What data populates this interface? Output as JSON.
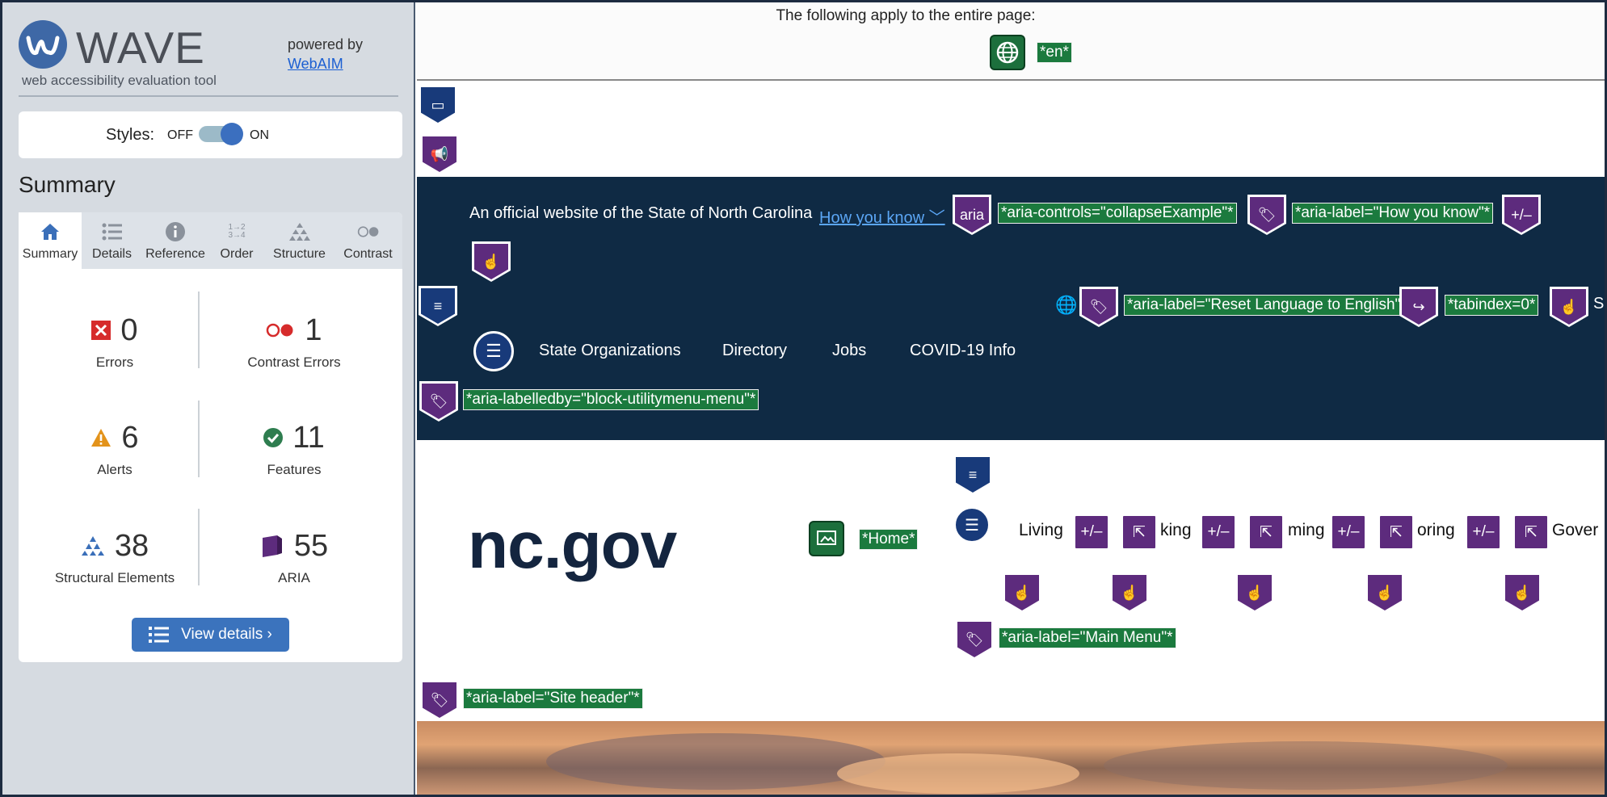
{
  "sidebar": {
    "logo_text": "WAVE",
    "tagline": "web accessibility evaluation tool",
    "powered_by": "powered by",
    "webaim_link": "WebAIM",
    "styles": {
      "label": "Styles:",
      "off": "OFF",
      "on": "ON",
      "enabled": true
    },
    "summary_heading": "Summary",
    "tabs": [
      {
        "label": "Summary",
        "icon": "home-icon",
        "active": true
      },
      {
        "label": "Details",
        "icon": "list-icon",
        "active": false
      },
      {
        "label": "Reference",
        "icon": "info-icon",
        "active": false
      },
      {
        "label": "Order",
        "icon": "order-icon",
        "active": false
      },
      {
        "label": "Structure",
        "icon": "structure-icon",
        "active": false
      },
      {
        "label": "Contrast",
        "icon": "contrast-icon",
        "active": false
      }
    ],
    "stats": {
      "errors": {
        "count": "0",
        "label": "Errors"
      },
      "contrast_errors": {
        "count": "1",
        "label": "Contrast Errors"
      },
      "alerts": {
        "count": "6",
        "label": "Alerts"
      },
      "features": {
        "count": "11",
        "label": "Features"
      },
      "structural": {
        "count": "38",
        "label": "Structural Elements"
      },
      "aria": {
        "count": "55",
        "label": "ARIA"
      }
    },
    "view_details": "View details ›"
  },
  "page": {
    "top_note": "The following apply to the entire page:",
    "lang_tag": "*en*",
    "official_text": "An official website of the State of North Carolina",
    "how_you_know": "How you know",
    "aria_icon_text": "aria",
    "tags": {
      "aria_controls": "*aria-controls=\"collapseExample\"*",
      "aria_label_how": "*aria-label=\"How you know\"*",
      "aria_label_reset": "*aria-label=\"Reset Language to English\"*",
      "tabindex": "*tabindex=0*",
      "aria_labelledby": "*aria-labelledby=\"block-utilitymenu-menu\"*",
      "home": "*Home*",
      "aria_label_main_menu": "*aria-label=\"Main Menu\"*",
      "aria_label_site_header": "*aria-label=\"Site header\"*"
    },
    "expand_symbol": "+/–",
    "truncated_right": "S",
    "nav_links": [
      "State Organizations",
      "Directory",
      "Jobs",
      "COVID-19 Info"
    ],
    "logo": "nc.gov",
    "menu_words": [
      "Living",
      "king",
      "ming",
      "oring",
      "Gover"
    ]
  }
}
